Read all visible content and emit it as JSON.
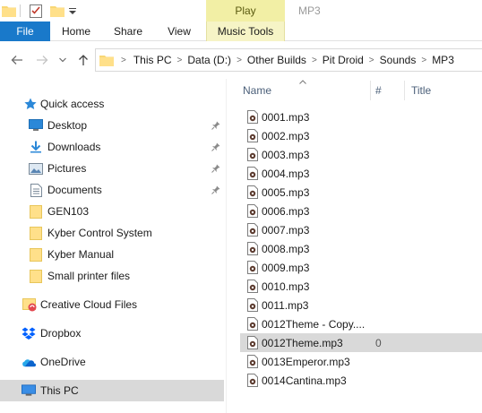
{
  "ribbon": {
    "context_tab_header": "Play",
    "window_title": "MP3",
    "tabs": [
      {
        "label": "File"
      },
      {
        "label": "Home"
      },
      {
        "label": "Share"
      },
      {
        "label": "View"
      },
      {
        "label": "Music Tools"
      }
    ]
  },
  "address": {
    "crumbs": [
      "This PC",
      "Data (D:)",
      "Other Builds",
      "Pit Droid",
      "Sounds",
      "MP3"
    ]
  },
  "navigation": {
    "quick_access": "Quick access",
    "pinned": [
      {
        "label": "Desktop",
        "icon": "desktop-icon"
      },
      {
        "label": "Downloads",
        "icon": "download-icon"
      },
      {
        "label": "Pictures",
        "icon": "pictures-icon"
      },
      {
        "label": "Documents",
        "icon": "documents-icon"
      }
    ],
    "folders": [
      "GEN103",
      "Kyber Control System",
      "Kyber Manual",
      "Small printer files"
    ],
    "creative_cloud": "Creative Cloud Files",
    "dropbox": "Dropbox",
    "onedrive": "OneDrive",
    "this_pc": "This PC"
  },
  "columns": {
    "name": "Name",
    "number": "#",
    "title": "Title"
  },
  "files": [
    {
      "name": "0001.mp3",
      "number": ""
    },
    {
      "name": "0002.mp3",
      "number": ""
    },
    {
      "name": "0003.mp3",
      "number": ""
    },
    {
      "name": "0004.mp3",
      "number": ""
    },
    {
      "name": "0005.mp3",
      "number": ""
    },
    {
      "name": "0006.mp3",
      "number": ""
    },
    {
      "name": "0007.mp3",
      "number": ""
    },
    {
      "name": "0008.mp3",
      "number": ""
    },
    {
      "name": "0009.mp3",
      "number": ""
    },
    {
      "name": "0010.mp3",
      "number": ""
    },
    {
      "name": "0011.mp3",
      "number": ""
    },
    {
      "name": "0012Theme - Copy....",
      "number": ""
    },
    {
      "name": "0012Theme.mp3",
      "number": "0"
    },
    {
      "name": "0013Emperor.mp3",
      "number": ""
    },
    {
      "name": "0014Cantina.mp3",
      "number": ""
    }
  ],
  "selected_file": "0012Theme.mp3",
  "colors": {
    "file_tab": "#1979ca",
    "music_tools_tab": "#f6f4c6",
    "play_header": "#f2efa5",
    "selection": "#d9d9d9",
    "accent": "#2b88d8"
  }
}
